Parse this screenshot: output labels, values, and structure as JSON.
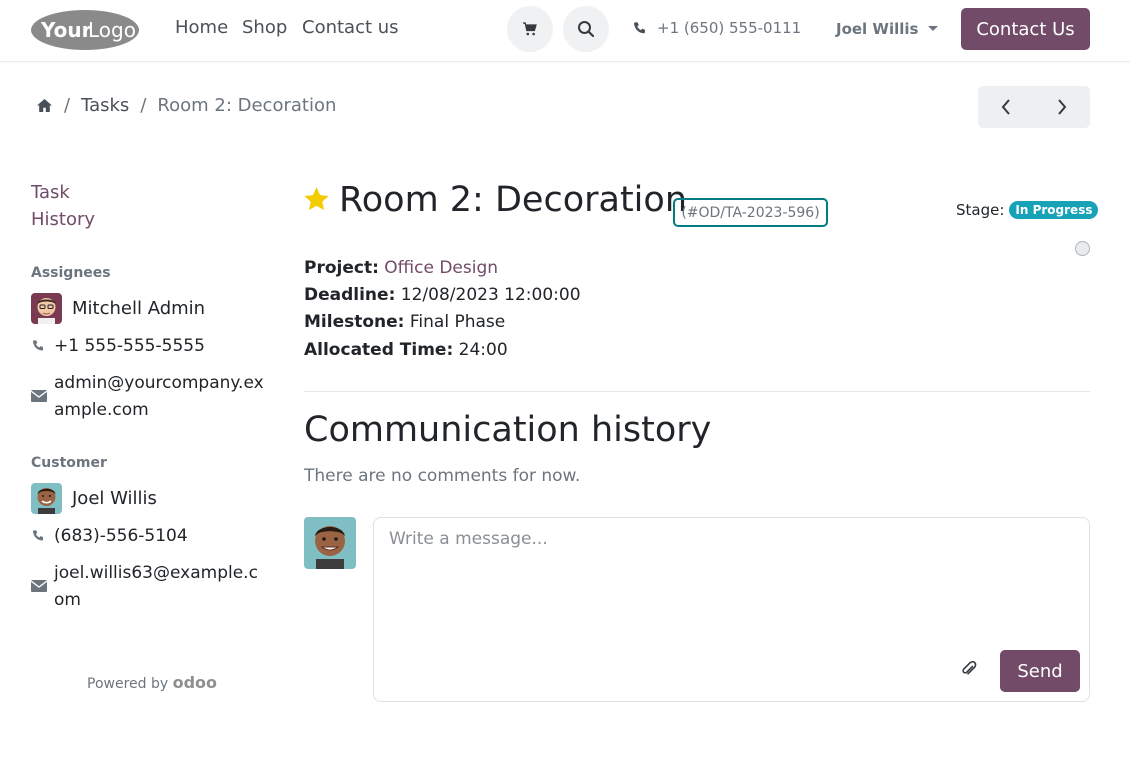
{
  "header": {
    "logo_text": "YourLogo",
    "nav": [
      "Home",
      "Shop",
      "Contact us"
    ],
    "phone": "+1 (650) 555-0111",
    "user": "Joel Willis",
    "contact_button": "Contact Us"
  },
  "breadcrumb": {
    "parent": "Tasks",
    "current": "Room 2: Decoration"
  },
  "sidebar": {
    "links": [
      "Task",
      "History"
    ],
    "assignees_heading": "Assignees",
    "assignee": {
      "name": "Mitchell Admin",
      "phone": "+1 555-555-5555",
      "email": "admin@yourcompany.example.com"
    },
    "customer_heading": "Customer",
    "customer": {
      "name": "Joel Willis",
      "phone": "(683)-556-5104",
      "email": "joel.willis63@example.com"
    },
    "powered_by": "Powered by",
    "powered_brand": "odoo"
  },
  "task": {
    "title": "Room 2: Decoration",
    "reference": "(#OD/TA-2023-596)",
    "stage_label": "Stage:",
    "stage": "In Progress",
    "fields": [
      {
        "label": "Project:",
        "value": "Office Design"
      },
      {
        "label": "Deadline:",
        "value": "12/08/2023 12:00:00"
      },
      {
        "label": "Milestone:",
        "value": "Final Phase"
      },
      {
        "label": "Allocated Time:",
        "value": "24:00"
      }
    ]
  },
  "communication": {
    "title": "Communication history",
    "empty": "There are no comments for now.",
    "placeholder": "Write a message...",
    "send": "Send"
  },
  "colors": {
    "brand": "#714b67",
    "stage_badge": "#17a2b8",
    "star": "#f3cc00",
    "focus_border": "#017e84"
  }
}
